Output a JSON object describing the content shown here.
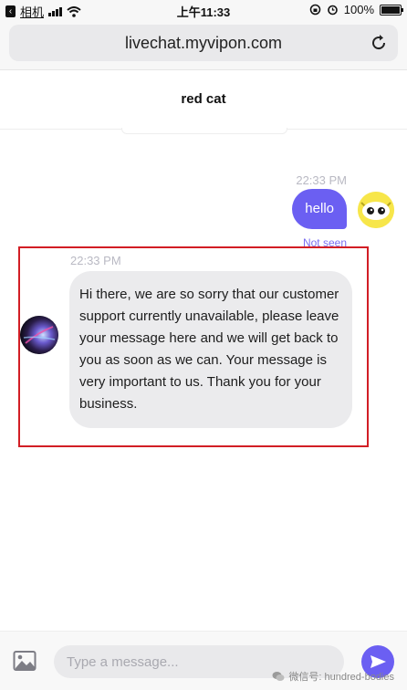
{
  "status_bar": {
    "back_app": "相机",
    "time": "上午11:33",
    "battery": "100%"
  },
  "browser": {
    "url": "livechat.myvipon.com"
  },
  "chat": {
    "title": "red cat"
  },
  "messages": {
    "outgoing": {
      "time": "22:33 PM",
      "text": "hello",
      "status": "Not seen"
    },
    "incoming": {
      "time": "22:33 PM",
      "text": "Hi there, we are so sorry that our customer support currently unavailable, please leave your message here and we will get back to you as soon as we can. Your message is very important to us. Thank you for your business."
    }
  },
  "composer": {
    "placeholder": "Type a message..."
  },
  "watermark": "微信号: hundred-bodies",
  "colors": {
    "accent": "#6b5ff2",
    "highlight": "#d21e25",
    "bubble_in": "#ebebed"
  }
}
